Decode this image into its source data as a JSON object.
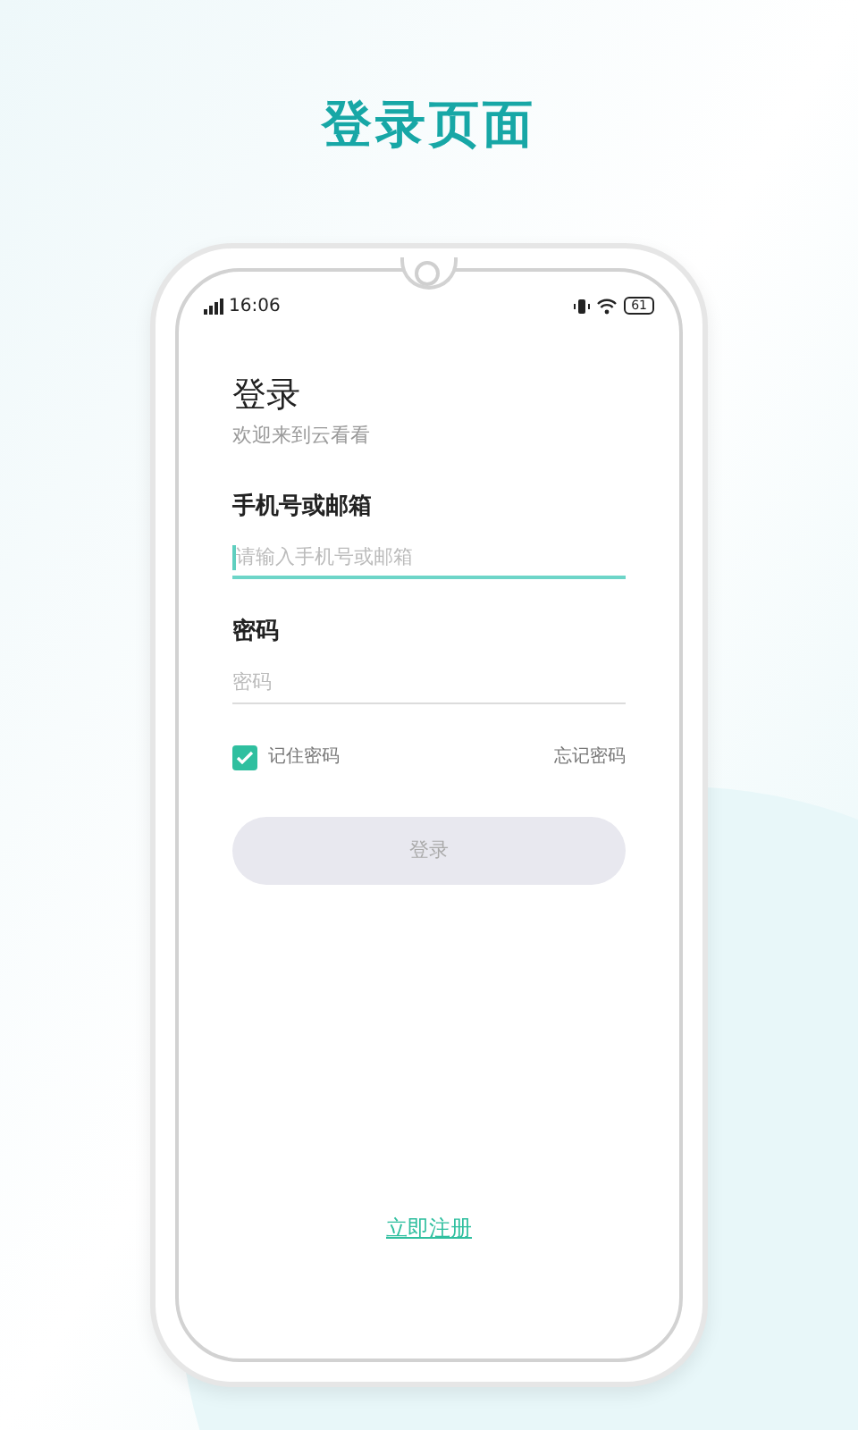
{
  "headline": "登录页面",
  "status_bar": {
    "time": "16:06",
    "battery": "61"
  },
  "login": {
    "title": "登录",
    "subtitle": "欢迎来到云看看",
    "fields": [
      {
        "label": "手机号或邮箱",
        "placeholder": "请输入手机号或邮箱",
        "focused": true
      },
      {
        "label": "密码",
        "placeholder": "密码",
        "focused": false
      }
    ],
    "remember": {
      "label": "记住密码",
      "checked": true
    },
    "forgot": "忘记密码",
    "submit": {
      "label": "登录",
      "disabled": true
    },
    "register": "立即注册"
  }
}
